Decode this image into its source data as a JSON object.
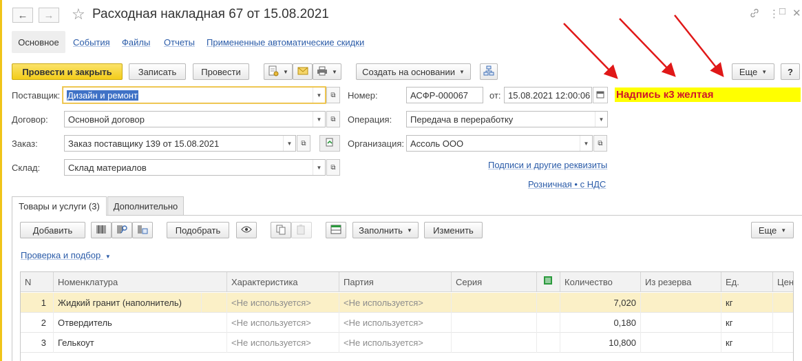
{
  "window": {
    "title": "Расходная накладная 67 от 15.08.2021",
    "icons": {
      "back": "arrow-left",
      "forward": "arrow-right",
      "favorite": "star",
      "link": "link-icon",
      "menu": "kebab",
      "maximize": "square",
      "close": "x"
    }
  },
  "sections": [
    {
      "label": "Основное",
      "active": true
    },
    {
      "label": "События"
    },
    {
      "label": "Файлы"
    },
    {
      "label": "Отчеты"
    },
    {
      "label": "Примененные автоматические скидки"
    }
  ],
  "toolbar": {
    "post_close": "Провести и закрыть",
    "save": "Записать",
    "post": "Провести",
    "create_based": "Создать на основании",
    "more": "Еще",
    "help": "?"
  },
  "form": {
    "supplier_label": "Поставщик:",
    "supplier_value": "Дизайн и ремонт",
    "contract_label": "Договор:",
    "contract_value": "Основной договор",
    "order_label": "Заказ:",
    "order_value": "Заказ поставщику 139 от 15.08.2021",
    "warehouse_label": "Склад:",
    "warehouse_value": "Склад материалов",
    "number_label": "Номер:",
    "number_value": "АСФР-000067",
    "date_label": "от:",
    "date_value": "15.08.2021 12:00:06",
    "operation_label": "Операция:",
    "operation_value": "Передача в переработку",
    "organization_label": "Организация:",
    "organization_value": "Ассоль ООО",
    "signatures_link": "Подписи и другие реквизиты",
    "vat_link": "Розничная • с НДС",
    "yellow_note": "Надпись к3 желтая"
  },
  "tabs": [
    {
      "label": "Товары и услуги (3)",
      "active": true
    },
    {
      "label": "Дополнительно"
    }
  ],
  "table_toolbar": {
    "add": "Добавить",
    "pick": "Подобрать",
    "fill": "Заполнить",
    "change": "Изменить",
    "more": "Еще",
    "check_link": "Проверка и подбор"
  },
  "table": {
    "headers": [
      "N",
      "Номенклатура",
      "Характеристика",
      "Партия",
      "Серия",
      "Количество",
      "Из резерва",
      "Ед.",
      "Цена"
    ],
    "rows": [
      {
        "n": "1",
        "item": "Жидкий гранит (наполнитель)",
        "char": "<Не используется>",
        "batch": "<Не используется>",
        "qty": "7,020",
        "unit": "кг"
      },
      {
        "n": "2",
        "item": "Отвердитель",
        "char": "<Не используется>",
        "batch": "<Не используется>",
        "qty": "0,180",
        "unit": "кг"
      },
      {
        "n": "3",
        "item": "Гелькоут",
        "char": "<Не используется>",
        "batch": "<Не используется>",
        "qty": "10,800",
        "unit": "кг"
      }
    ]
  },
  "colors": {
    "accent_yellow": "#f3cd1a",
    "highlight": "#ffff00",
    "note_text": "#d0152a",
    "arrow": "#e01818",
    "link": "#2a5ba8"
  }
}
